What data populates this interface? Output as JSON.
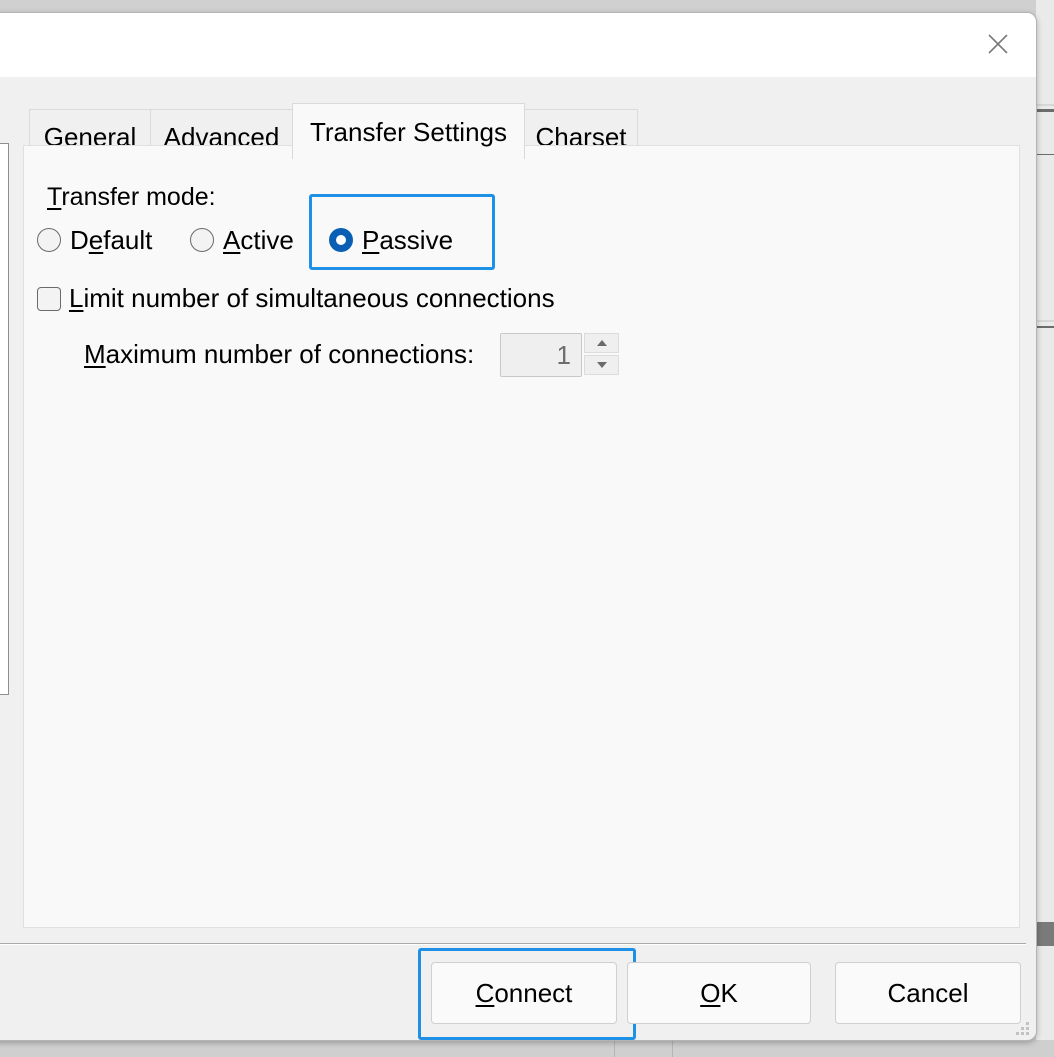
{
  "window": {
    "close_icon": "close-icon"
  },
  "tabs": [
    {
      "label": "General",
      "active": false
    },
    {
      "label": "Advanced",
      "active": false
    },
    {
      "label": "Transfer Settings",
      "active": true
    },
    {
      "label": "Charset",
      "active": false
    }
  ],
  "transfer": {
    "mode_label_accel": "T",
    "mode_label_rest": "ransfer mode:",
    "options": [
      {
        "pre": "D",
        "accel": "e",
        "post": "fault",
        "label": "Default",
        "checked": false
      },
      {
        "pre": "",
        "accel": "A",
        "post": "ctive",
        "label": "Active",
        "checked": false
      },
      {
        "pre": "",
        "accel": "P",
        "post": "assive",
        "label": "Passive",
        "checked": true
      }
    ],
    "selected": "Passive"
  },
  "limit": {
    "checkbox_accel": "L",
    "checkbox_rest": "imit number of simultaneous connections",
    "checked": false,
    "max_label_accel": "M",
    "max_label_rest": "aximum number of connections:",
    "max_value": "1",
    "enabled": false
  },
  "buttons": {
    "connect_accel": "C",
    "connect_rest": "onnect",
    "ok_accel": "O",
    "ok_rest": "K",
    "cancel": "Cancel"
  },
  "colors": {
    "focus": "#1e90e6",
    "radio_checked": "#0a5fb4"
  }
}
